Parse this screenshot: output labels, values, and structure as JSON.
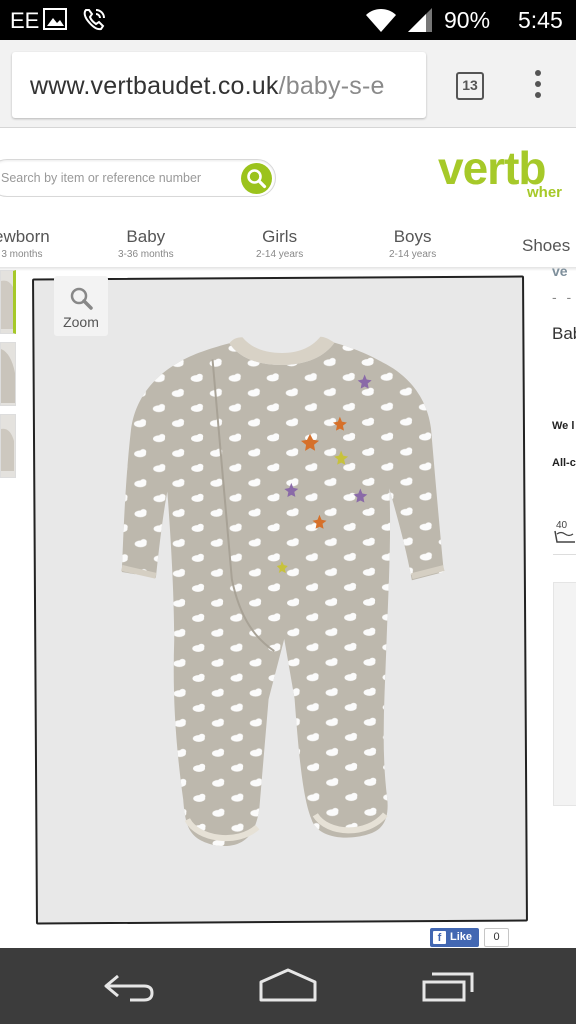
{
  "status_bar": {
    "carrier": "EE",
    "battery": "90%",
    "time": "5:45",
    "icons": [
      "image-icon",
      "phone-call-icon",
      "wifi-icon",
      "signal-icon",
      "battery-icon"
    ]
  },
  "browser": {
    "url_domain": "www.vertbaudet.co.uk",
    "url_path": "/baby-s-e",
    "tab_count": "13"
  },
  "site": {
    "search_placeholder": "Search by item or reference number",
    "logo_text": "vertb",
    "logo_sub": "wher",
    "brand_color": "#a6c929",
    "nav": [
      {
        "label": "ewborn",
        "sub": "3 months"
      },
      {
        "label": "Baby",
        "sub": "3-36 months"
      },
      {
        "label": "Girls",
        "sub": "2-14 years"
      },
      {
        "label": "Boys",
        "sub": "2-14 years"
      },
      {
        "label": "Shoes",
        "sub": ""
      }
    ],
    "zoom_label": "Zoom",
    "right_panel": {
      "brand": "ve",
      "dashes": "- -",
      "title": "Bab",
      "we_text": "We l",
      "all_text": "All-c",
      "wash_label": "40"
    },
    "like_label": "Like",
    "like_count": "0"
  }
}
